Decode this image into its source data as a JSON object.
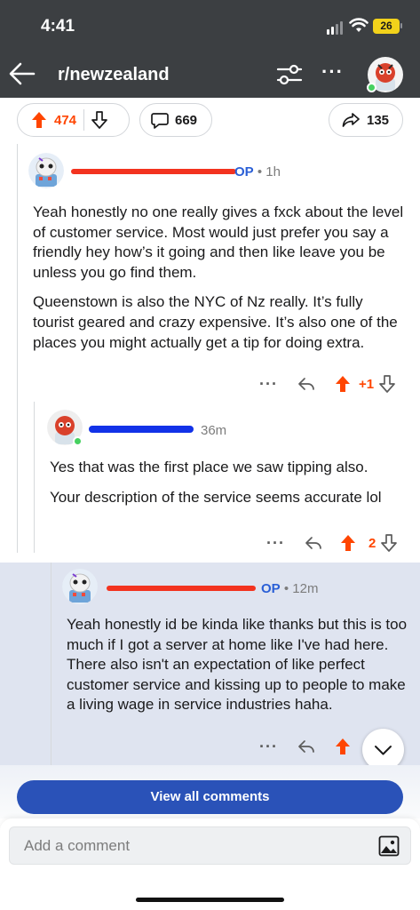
{
  "status_bar": {
    "time": "4:41",
    "battery": "26"
  },
  "header": {
    "subreddit": "r/newzealand"
  },
  "post_bar": {
    "upvotes": "474",
    "comments": "669",
    "shares": "135"
  },
  "comments": [
    {
      "author_badge": "OP",
      "time": "1h",
      "body": [
        "Yeah honestly no one really gives a fxck about the level of customer service. Most would just prefer you say a friendly hey how’s it going and then like leave you be unless you go find them.",
        "Queenstown is also the NYC of Nz really. It’s fully tourist geared and crazy expensive. It’s also one of the places you might actually get a tip for doing extra."
      ],
      "score": "+1"
    },
    {
      "time": "36m",
      "body": [
        "Yes that was the first place we saw tipping also.",
        "Your description of the service seems accurate lol"
      ],
      "score": "2"
    },
    {
      "author_badge": "OP",
      "time": "12m",
      "body": [
        "Yeah honestly id be kinda like thanks but this is too much if I got a server at home like I've had here. There also isn't an expectation of like perfect customer service and kissing up to people to make a living wage in service industries haha."
      ]
    }
  ],
  "buttons": {
    "view_all": "View all comments"
  },
  "composer": {
    "placeholder": "Add a comment"
  },
  "icons": {
    "back": "back-arrow-icon",
    "filter": "sliders-icon",
    "more": "ellipsis-icon",
    "upvote": "upvote-arrow-icon",
    "downvote": "downvote-arrow-icon",
    "comment": "speech-bubble-icon",
    "share": "share-arrow-icon",
    "reply": "reply-arrow-icon",
    "scroll_down": "chevron-down-icon",
    "image": "image-icon"
  },
  "colors": {
    "upvote": "#ff4500",
    "op_badge": "#2a5fd6",
    "button": "#2a52b8",
    "online": "#46d160"
  }
}
